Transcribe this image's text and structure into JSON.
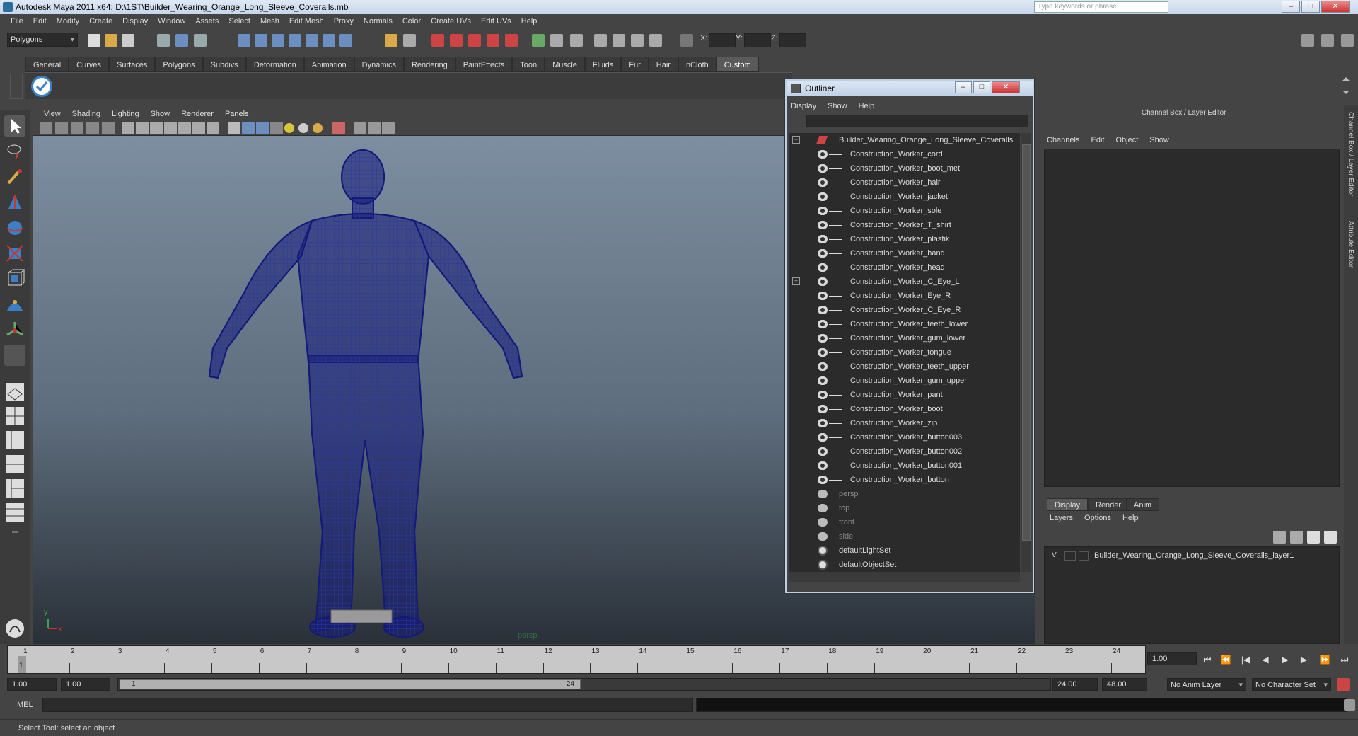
{
  "window": {
    "title": "Autodesk Maya 2011 x64: D:\\1ST\\Builder_Wearing_Orange_Long_Sleeve_Coveralls.mb",
    "search_placeholder": "Type keywords or phrase",
    "min": "–",
    "max": "□",
    "close": "✕"
  },
  "menubar": [
    "File",
    "Edit",
    "Modify",
    "Create",
    "Display",
    "Window",
    "Assets",
    "Select",
    "Mesh",
    "Edit Mesh",
    "Proxy",
    "Normals",
    "Color",
    "Create UVs",
    "Edit UVs",
    "Help"
  ],
  "statusline": {
    "mode": "Polygons",
    "x_label": "X:",
    "y_label": "Y:",
    "z_label": "Z:"
  },
  "shelf": {
    "tabs": [
      "General",
      "Curves",
      "Surfaces",
      "Polygons",
      "Subdivs",
      "Deformation",
      "Animation",
      "Dynamics",
      "Rendering",
      "PaintEffects",
      "Toon",
      "Muscle",
      "Fluids",
      "Fur",
      "Hair",
      "nCloth",
      "Custom"
    ],
    "active_tab": "Custom"
  },
  "viewport": {
    "menu": [
      "View",
      "Shading",
      "Lighting",
      "Show",
      "Renderer",
      "Panels"
    ],
    "camera_label": "persp",
    "axis_x": "x",
    "axis_y": "y",
    "wire_color": "#141a7a"
  },
  "outliner": {
    "title": "Outliner",
    "menu": [
      "Display",
      "Show",
      "Help"
    ],
    "root": "Builder_Wearing_Orange_Long_Sleeve_Coveralls",
    "children": [
      "Construction_Worker_cord",
      "Construction_Worker_boot_met",
      "Construction_Worker_hair",
      "Construction_Worker_jacket",
      "Construction_Worker_sole",
      "Construction_Worker_T_shirt",
      "Construction_Worker_plastik",
      "Construction_Worker_hand",
      "Construction_Worker_head",
      "Construction_Worker_C_Eye_L",
      "Construction_Worker_Eye_R",
      "Construction_Worker_C_Eye_R",
      "Construction_Worker_teeth_lower",
      "Construction_Worker_gum_lower",
      "Construction_Worker_tongue",
      "Construction_Worker_teeth_upper",
      "Construction_Worker_gum_upper",
      "Construction_Worker_pant",
      "Construction_Worker_boot",
      "Construction_Worker_zip",
      "Construction_Worker_button003",
      "Construction_Worker_button002",
      "Construction_Worker_button001",
      "Construction_Worker_button"
    ],
    "cameras": [
      "persp",
      "top",
      "front",
      "side"
    ],
    "sets": [
      "defaultLightSet",
      "defaultObjectSet"
    ]
  },
  "channelbox": {
    "title": "Channel Box / Layer Editor",
    "menu": [
      "Channels",
      "Edit",
      "Object",
      "Show"
    ],
    "layer_tabs": [
      "Display",
      "Render",
      "Anim"
    ],
    "layer_menu": [
      "Layers",
      "Options",
      "Help"
    ],
    "layer_visible": "V",
    "layer_name": "Builder_Wearing_Orange_Long_Sleeve_Coveralls_layer1",
    "side_tabs": [
      "Channel Box / Layer Editor",
      "Attribute Editor"
    ]
  },
  "timeline": {
    "ticks": [
      "1",
      "2",
      "3",
      "4",
      "5",
      "6",
      "7",
      "8",
      "9",
      "10",
      "11",
      "12",
      "13",
      "14",
      "15",
      "16",
      "17",
      "18",
      "19",
      "20",
      "21",
      "22",
      "23",
      "24"
    ],
    "current_marker": "1",
    "current_frame": "1.00",
    "playback": [
      "⏮",
      "⏪",
      "|◀",
      "◀",
      "▶",
      "▶|",
      "⏩",
      "⏭"
    ]
  },
  "range": {
    "start": "1.00",
    "playback_start": "1.00",
    "knob_start": "1",
    "knob_end": "24",
    "playback_end": "24.00",
    "end": "48.00",
    "anim_layer": "No Anim Layer",
    "character_set": "No Character Set"
  },
  "command": {
    "label": "MEL"
  },
  "helpline": "Select Tool: select an object"
}
